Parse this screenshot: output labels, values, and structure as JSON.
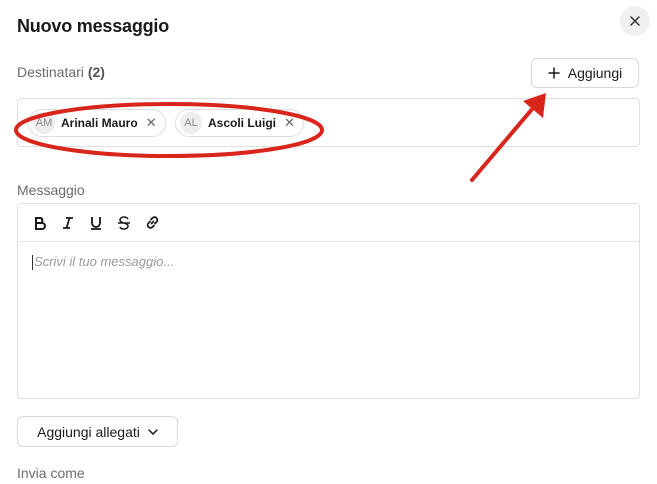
{
  "dialog": {
    "title": "Nuovo messaggio",
    "close_icon": "close-icon"
  },
  "recipients": {
    "label": "Destinatari",
    "count": "(2)",
    "add_label": "Aggiungi",
    "items": [
      {
        "initials": "AM",
        "name": "Arinali Mauro"
      },
      {
        "initials": "AL",
        "name": "Ascoli Luigi"
      }
    ]
  },
  "message": {
    "label": "Messaggio",
    "placeholder": "Scrivi il tuo messaggio...",
    "toolbar": [
      "bold-icon",
      "italic-icon",
      "underline-icon",
      "strikethrough-icon",
      "link-icon"
    ]
  },
  "attachments": {
    "label": "Aggiungi allegati"
  },
  "send_as": {
    "label": "Invia come"
  },
  "annotations": {
    "color": "#d9261c"
  }
}
